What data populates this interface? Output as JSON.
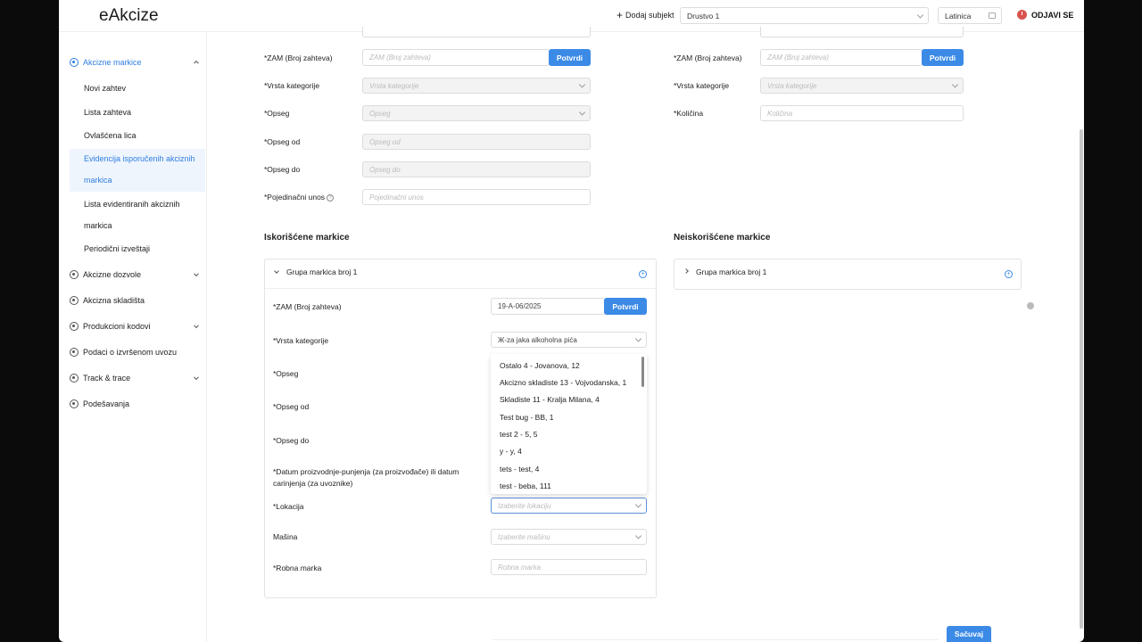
{
  "header": {
    "logo": "eAkcize",
    "add_subject": "Dodaj subjekt",
    "company_select": "Drustvo 1",
    "language_select": "Latinica",
    "logout": "ODJAVI SE"
  },
  "sidebar": {
    "akcizne_markice": "Akcizne markice",
    "sub_items": [
      "Novi zahtev",
      "Lista zahteva",
      "Ovlašćena lica",
      "Evidencija isporučenih akciznih",
      "markica",
      "Lista evidentiranih akciznih",
      "markica",
      "Periodični izveštaji"
    ],
    "items": [
      "Akcizne dozvole",
      "Akcizna skladišta",
      "Produkcioni kodovi",
      "Podaci o izvršenom uvozu",
      "Track & trace",
      "Podešavanja"
    ]
  },
  "top_left_form": {
    "zam_label": "*ZAM (Broj zahteva)",
    "zam_placeholder": "ZAM (Broj zahteva)",
    "confirm": "Potvrdi",
    "vrsta_label": "*Vrsta kategorije",
    "vrsta_placeholder": "Vrsta kategorije",
    "opseg_label": "*Opseg",
    "opseg_placeholder": "Opseg",
    "opseg_od_label": "*Opseg od",
    "opseg_od_placeholder": "Opseg od",
    "opseg_do_label": "*Opseg do",
    "opseg_do_placeholder": "Opseg do",
    "pojedinacni_label": "*Pojedinačni unos",
    "pojedinacni_placeholder": "Pojedinačni unos"
  },
  "top_right_form": {
    "zam_label": "*ZAM (Broj zahteva)",
    "zam_placeholder": "ZAM (Broj zahteva)",
    "confirm": "Potvrdi",
    "vrsta_label": "*Vrsta kategorije",
    "vrsta_placeholder": "Vrsta kategorije",
    "kolicina_label": "*Količina",
    "kolicina_placeholder": "Količina"
  },
  "used": {
    "title": "Iskorišćene markice",
    "group": "Grupa markica broj 1",
    "zam_label": "*ZAM (Broj zahteva)",
    "zam_value": "19-A-06/2025",
    "confirm": "Potvrdi",
    "vrsta_label": "*Vrsta kategorije",
    "vrsta_value": "Ж-za jaka alkoholna pića",
    "opseg_label": "*Opseg",
    "opseg_od_label": "*Opseg od",
    "opseg_do_label": "*Opseg do",
    "datum_label_1": "*Datum proizvodnje-punjenja (za proizvođače) ili datum",
    "datum_label_2": "carinjenja (za uvoznike)",
    "lokacija_label": "*Lokacija",
    "lokacija_placeholder": "Izaberite lokaciju",
    "masina_label": "Mašina",
    "masina_placeholder": "Izaberite mašinu",
    "robna_label": "*Robna marka",
    "robna_placeholder": "Robna marka"
  },
  "unused": {
    "title": "Neiskorišćene markice",
    "group": "Grupa markica broj 1"
  },
  "dropdown_options": [
    "Ostalo 4 - Jovanova, 12",
    "Akcizno skladiste 13 - Vojvodanska, 1",
    "Skladiste 11 - Kralja Milana, 4",
    "Test bug - BB, 1",
    "test 2 - 5, 5",
    "y - y, 4",
    "tets - test, 4",
    "test - beba, 111"
  ],
  "save": "Sačuvaj",
  "colors": {
    "primary": "#3b8ae6",
    "active_text": "#2f7de1",
    "active_bg": "#eef5fd"
  }
}
